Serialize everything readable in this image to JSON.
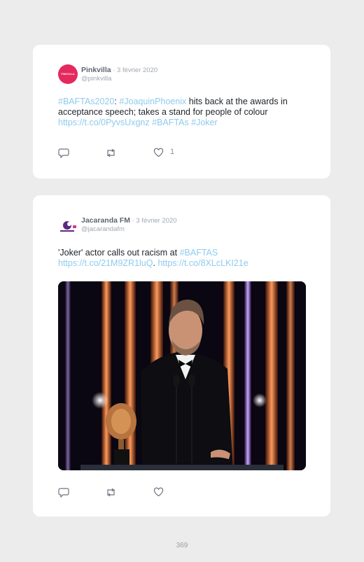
{
  "tweets": [
    {
      "avatar_text": "PINKVILLA",
      "name": "Pinkvilla",
      "date": " · 3 février 2020",
      "handle": "@pinkvilla",
      "text": {
        "tag1": "#BAFTAs2020",
        "sep": ": ",
        "tag2": "#JoaquinPhoenix",
        "body": " hits back at the awards in acceptance speech; takes a stand for people of colour",
        "url": "https://t.co/0PyvsUxgnz",
        "tag3": "#BAFTAs",
        "tag4": "#Joker"
      },
      "like_count": "1"
    },
    {
      "name": "Jacaranda FM",
      "date": " · 3 février 2020",
      "handle": "@jacarandafm",
      "text": {
        "body": "'Joker' actor calls out racism at ",
        "tag1": "#BAFTAS",
        "url1": "https://t.co/21M9ZR1luQ",
        "sep": ". ",
        "url2": "https://t.co/8XLcLKI21e"
      },
      "like_count": ""
    }
  ],
  "page_number": "369",
  "icons": {
    "reply": "reply-icon",
    "retweet": "retweet-icon",
    "like": "heart-icon"
  },
  "colors": {
    "link": "#8ecbee",
    "brand_pink": "#e4295f"
  }
}
